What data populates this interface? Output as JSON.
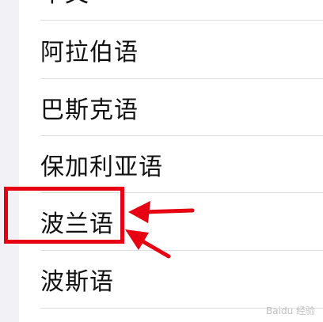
{
  "languages": {
    "items": [
      {
        "label": "中文"
      },
      {
        "label": "阿拉伯语"
      },
      {
        "label": "巴斯克语"
      },
      {
        "label": "保加利亚语"
      },
      {
        "label": "波兰语"
      },
      {
        "label": "波斯语"
      }
    ]
  },
  "annotation": {
    "highlight_color": "#e60012"
  },
  "watermark": {
    "text": "Baidu 经验"
  }
}
